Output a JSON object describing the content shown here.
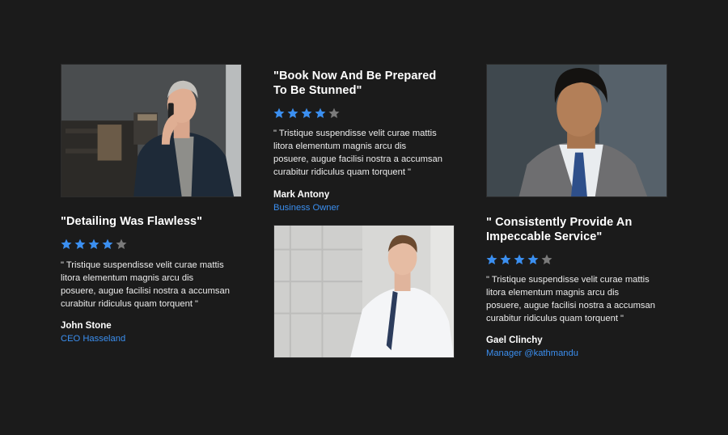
{
  "testimonials": [
    {
      "title": "\"Detailing Was Flawless\"",
      "rating": 4,
      "rating_max": 5,
      "quote_lines": [
        "\" Tristique suspendisse velit curae mattis",
        "litora elementum magnis arcu dis",
        "posuere, augue facilisi nostra a accumsan",
        "curabitur ridiculus quam torquent \""
      ],
      "name": "John Stone",
      "role": "CEO Hasseland"
    },
    {
      "title_lines": [
        "\"Book Now And Be Prepared",
        "To Be Stunned\""
      ],
      "rating": 4,
      "rating_max": 5,
      "quote_lines": [
        "\" Tristique suspendisse velit curae mattis",
        "litora elementum magnis arcu dis",
        "posuere, augue facilisi nostra a accumsan",
        "curabitur ridiculus quam torquent \""
      ],
      "name": "Mark Antony",
      "role": "Business Owner"
    },
    {
      "title_lines": [
        "\" Consistently Provide An",
        "Impeccable Service\""
      ],
      "rating": 4,
      "rating_max": 5,
      "quote_lines": [
        "\" Tristique suspendisse velit curae mattis",
        "litora elementum magnis arcu dis",
        "posuere, augue facilisi nostra a accumsan",
        "curabitur ridiculus quam torquent \""
      ],
      "name": "Gael Clinchy",
      "role": "Manager @kathmandu"
    }
  ],
  "colors": {
    "background": "#1b1b1b",
    "star_filled": "#3b8ff0",
    "star_empty": "#7a7a7a",
    "role_text": "#3b8ff0"
  }
}
